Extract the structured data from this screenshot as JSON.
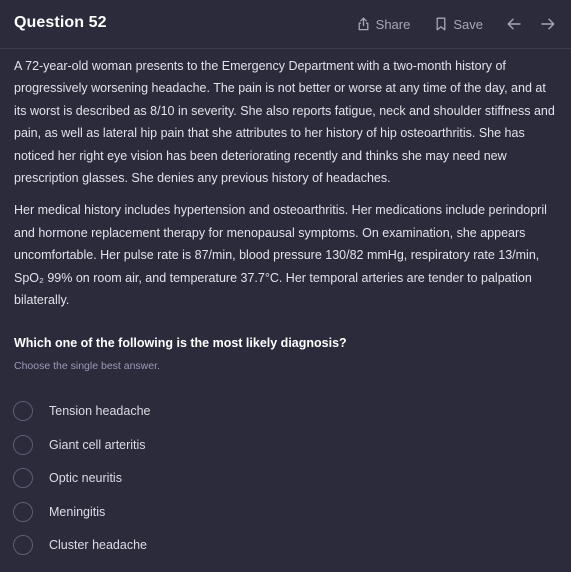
{
  "header": {
    "title": "Question 52",
    "share_label": "Share",
    "save_label": "Save",
    "icons": [
      "share-icon",
      "bookmark-icon",
      "arrow-left-icon",
      "arrow-right-icon"
    ]
  },
  "stem": {
    "paragraphs": [
      "A 72-year-old woman presents to the Emergency Department with a two-month history of progressively worsening headache. The pain is not better or worse at any time of the day, and at its worst is described as 8/10 in severity. She also reports fatigue, neck and shoulder stiffness and pain, as well as lateral hip pain that she attributes to her history of hip osteoarthritis. She has noticed her right eye vision has been deteriorating recently and thinks she may need new prescription glasses. She denies any previous history of headaches.",
      "Her medical history includes hypertension and osteoarthritis. Her medications include perindopril and hormone replacement therapy for menopausal symptoms. On examination, she appears uncomfortable. Her pulse rate is 87/min, blood pressure 130/82 mmHg, respiratory rate 13/min, SpO₂ 99% on room air, and temperature 37.7°C. Her temporal arteries are tender to palpation bilaterally."
    ]
  },
  "question": {
    "prompt": "Which one of the following is the most likely diagnosis?",
    "hint": "Choose the single best answer.",
    "options": [
      {
        "label": "Tension headache"
      },
      {
        "label": "Giant cell arteritis"
      },
      {
        "label": "Optic neuritis"
      },
      {
        "label": "Meningitis"
      },
      {
        "label": "Cluster headache"
      }
    ]
  },
  "colors": {
    "background": "#2b2b3c",
    "text": "#e2e2ea",
    "muted": "#a6a6b8",
    "hint": "#9a9ab8",
    "radio_border": "#5d5d74"
  }
}
